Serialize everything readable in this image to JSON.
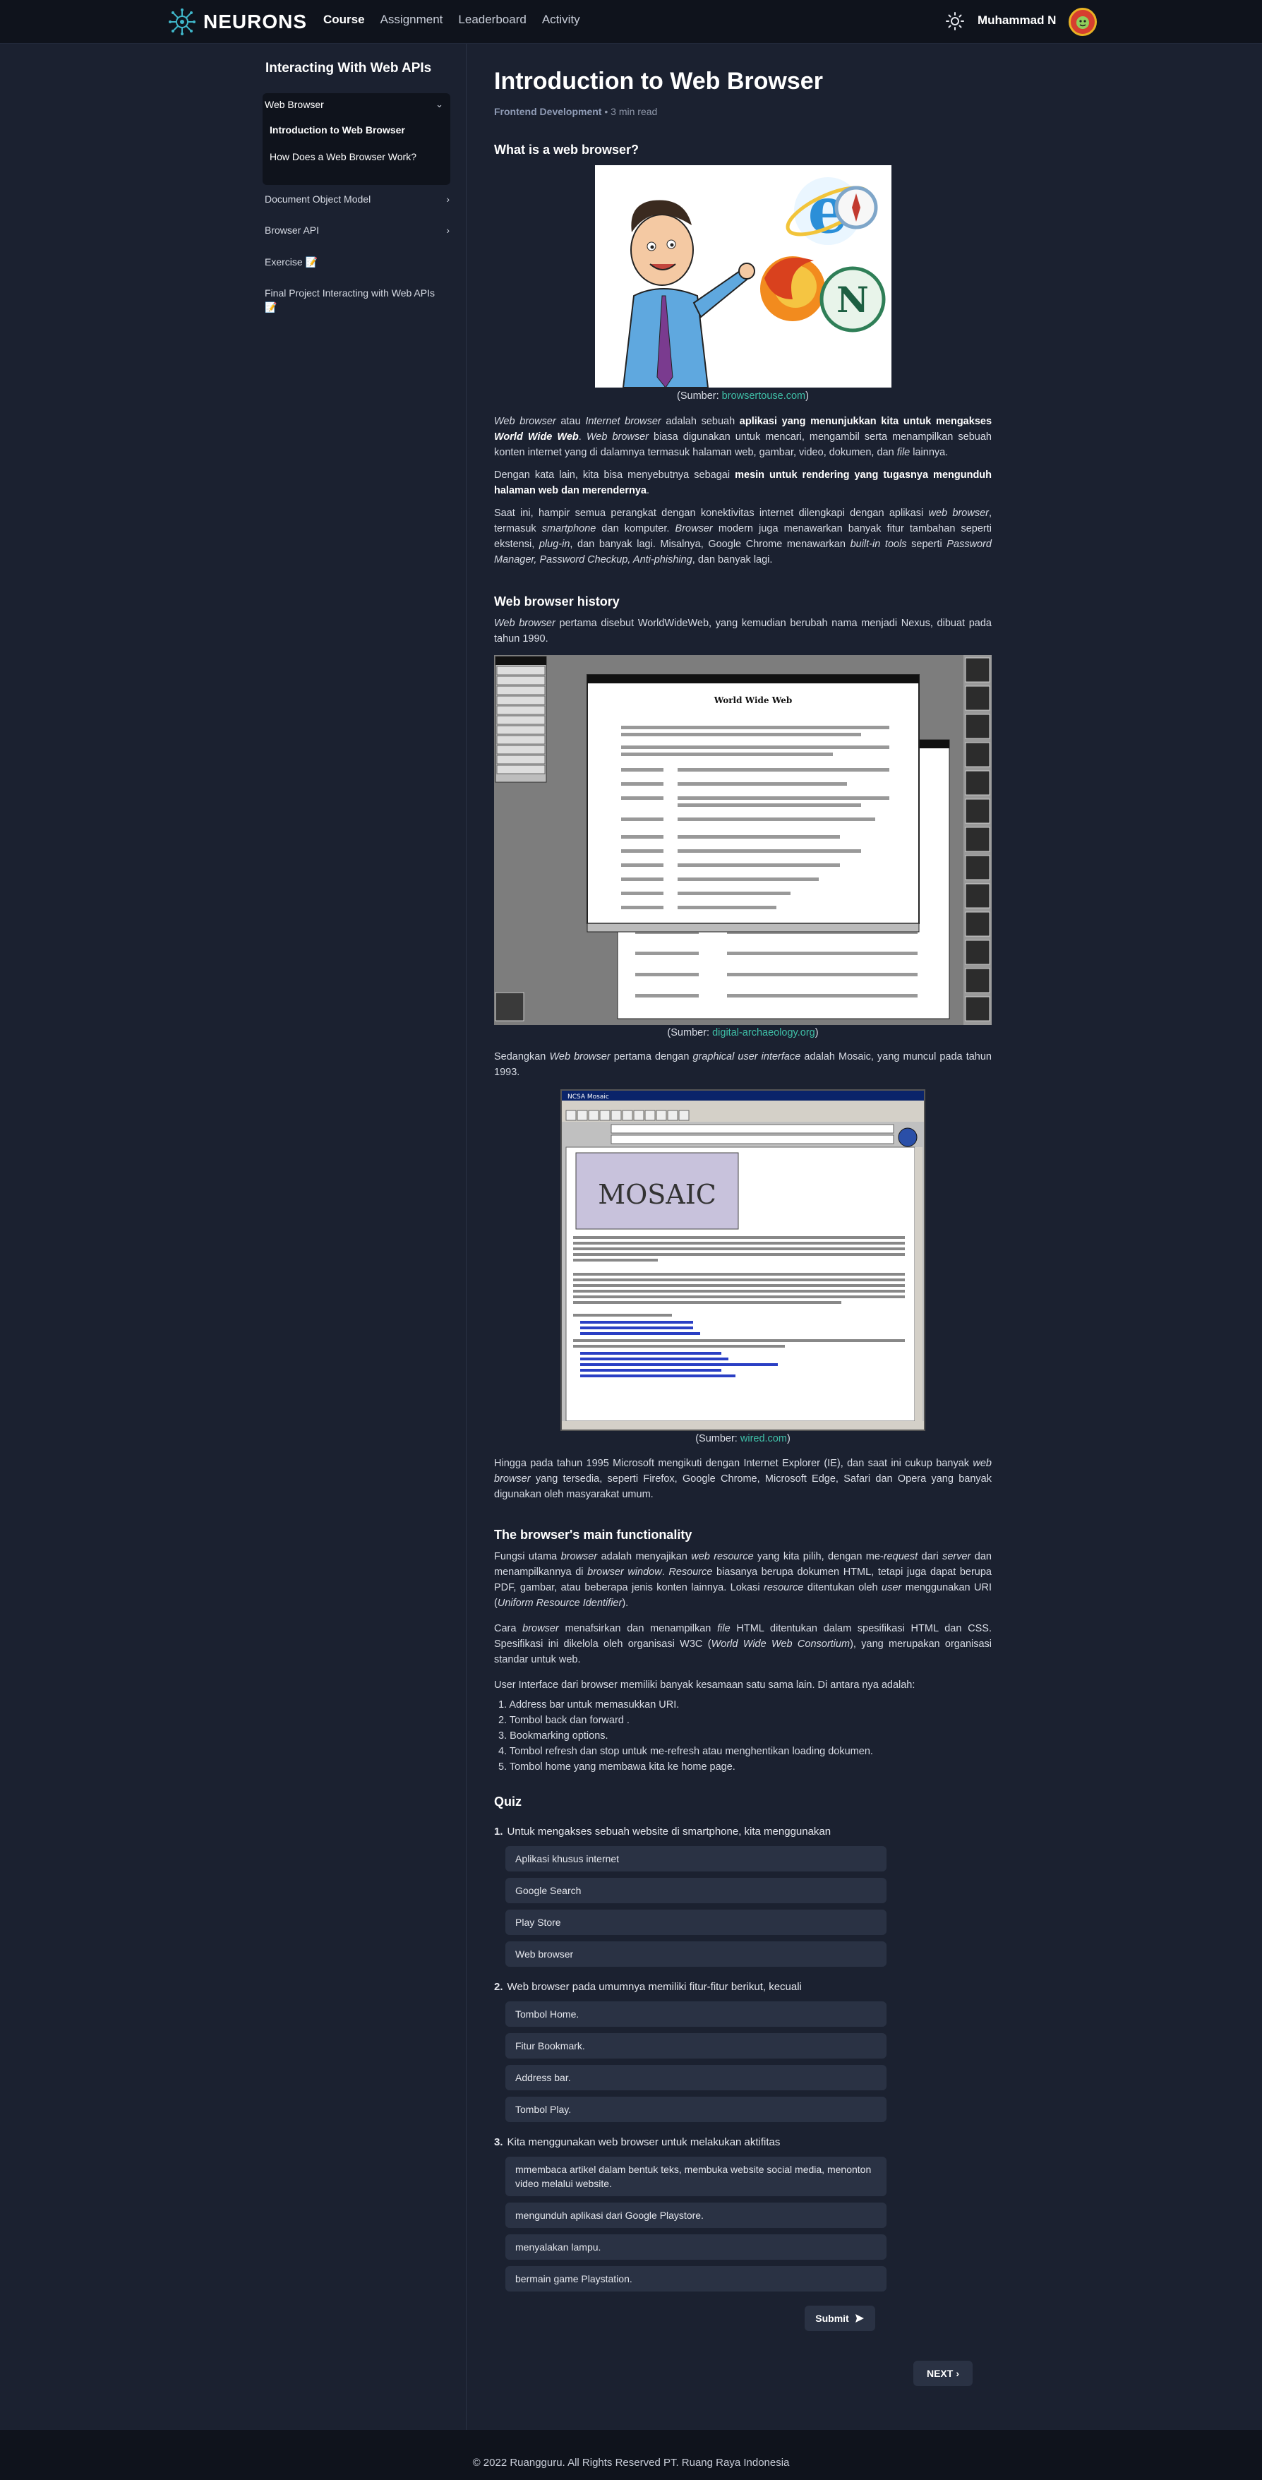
{
  "nav": {
    "brand": "NEURONS",
    "links": [
      "Course",
      "Assignment",
      "Leaderboard",
      "Activity"
    ],
    "user": "Muhammad N"
  },
  "sidebar": {
    "title": "Interacting With Web APIs",
    "group": "Web Browser",
    "sub_items": [
      "Introduction to Web Browser",
      "How Does a Web Browser Work?"
    ],
    "items": [
      "Document Object Model",
      "Browser API",
      "Exercise 📝",
      "Final Project Interacting with Web APIs 📝"
    ]
  },
  "article": {
    "title": "Introduction to Web Browser",
    "category": "Frontend Development",
    "read_time": "3 min read",
    "h_what": "What is a web browser?",
    "cap1_prefix": "(Sumber: ",
    "cap1_link": "browsertouse.com",
    "cap_suffix": ")",
    "h_history": "Web browser history",
    "cap2_prefix": "(Sumber: ",
    "cap2_link": "digital-archaeology.org",
    "cap3_prefix": "(Sumber: ",
    "cap3_link": "wired.com",
    "h_main": "The browser's main functionality",
    "ui_intro": "User Interface dari browser memiliki banyak kesamaan satu sama lain. Di antara nya adalah:",
    "list": [
      "1. Address bar untuk memasukkan URI.",
      "2. Tombol back dan forward .",
      "3. Bookmarking options.",
      "4. Tombol refresh dan stop untuk me-refresh atau menghentikan loading dokumen.",
      "5. Tombol home yang membawa kita ke home page."
    ]
  },
  "figures": {
    "fig2_title": "World Wide Web",
    "fig3_title": "NCSA Mosaic",
    "fig3_logo": "MOSAIC"
  },
  "quiz": {
    "title": "Quiz",
    "questions": [
      {
        "num": "1.",
        "text": "Untuk mengakses sebuah website di smartphone, kita menggunakan",
        "options": [
          "Aplikasi khusus internet",
          "Google Search",
          "Play Store",
          "Web browser"
        ]
      },
      {
        "num": "2.",
        "text": "Web browser pada umumnya memiliki fitur-fitur berikut, kecuali",
        "options": [
          "Tombol Home.",
          "Fitur Bookmark.",
          "Address bar.",
          "Tombol Play."
        ]
      },
      {
        "num": "3.",
        "text": "Kita menggunakan web browser untuk melakukan aktifitas",
        "options": [
          "mmembaca artikel dalam bentuk teks, membuka website social media, menonton video melalui website.",
          "mengunduh aplikasi dari Google Playstore.",
          "menyalakan lampu.",
          "bermain game Playstation."
        ]
      }
    ],
    "submit": "Submit",
    "next": "NEXT"
  },
  "footer": "© 2022 Ruangguru. All Rights Reserved PT. Ruang Raya Indonesia"
}
